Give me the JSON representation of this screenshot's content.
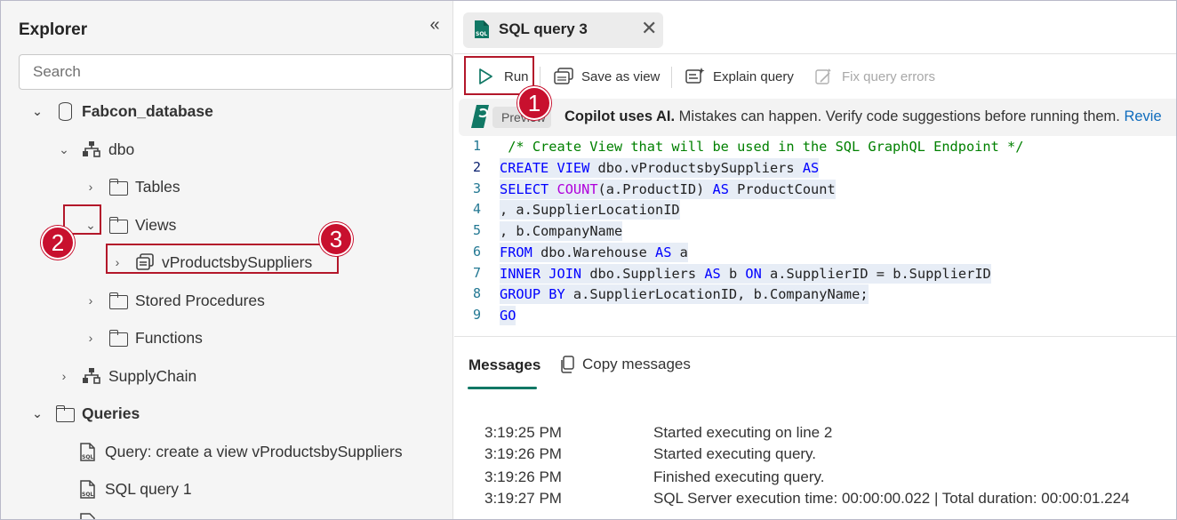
{
  "explorer": {
    "title": "Explorer",
    "collapse_icon": "double-chevron-left-icon",
    "search_placeholder": "Search",
    "tree": {
      "database": "Fabcon_database",
      "dbo": "dbo",
      "tables": "Tables",
      "views": "Views",
      "view_item": "vProductsbySuppliers",
      "stored_procedures": "Stored Procedures",
      "functions": "Functions",
      "supply_chain": "SupplyChain",
      "queries": "Queries",
      "query_1": "Query: create a view vProductsbySuppliers",
      "query_2": "SQL query 1"
    }
  },
  "tab": {
    "label": "SQL query 3",
    "icon": "sql-file-icon",
    "close_icon": "close-icon"
  },
  "toolbar": {
    "run": "Run",
    "save_as_view": "Save as view",
    "explain_query": "Explain query",
    "fix_query_errors": "Fix query errors"
  },
  "copilot": {
    "preview": "Preview",
    "bold": "Copilot uses AI.",
    "message": " Mistakes can happen. Verify code suggestions before running them. ",
    "link": "Revie"
  },
  "editor": {
    "line_numbers": [
      "1",
      "2",
      "3",
      "4",
      "5",
      "6",
      "7",
      "8",
      "9"
    ],
    "lines": [
      " /* Create View that will be used in the SQL GraphQL Endpoint */",
      "CREATE VIEW dbo.vProductsbySuppliers AS",
      "SELECT COUNT(a.ProductID) AS ProductCount",
      ", a.SupplierLocationID",
      ", b.CompanyName",
      "FROM dbo.Warehouse AS a",
      "INNER JOIN dbo.Suppliers AS b ON a.SupplierID = b.SupplierID",
      "GROUP BY a.SupplierLocationID, b.CompanyName;",
      "GO"
    ]
  },
  "messages": {
    "tab": "Messages",
    "copy": "Copy messages",
    "rows": [
      {
        "time": "3:19:25 PM",
        "text": "Started executing on line 2"
      },
      {
        "time": "3:19:26 PM",
        "text": "Started executing query."
      },
      {
        "time": "3:19:26 PM",
        "text": "Finished executing query."
      },
      {
        "time": "3:19:27 PM",
        "text": "SQL Server execution time: 00:00:00.022 | Total duration: 00:00:01.224"
      }
    ]
  },
  "annotations": {
    "badge_1": "1",
    "badge_2": "2",
    "badge_3": "3",
    "color": "#c8102e"
  },
  "colors": {
    "accent_teal": "#117865",
    "keyword_blue": "#0000ff",
    "comment_green": "#008000",
    "function_purple": "#af00db"
  }
}
